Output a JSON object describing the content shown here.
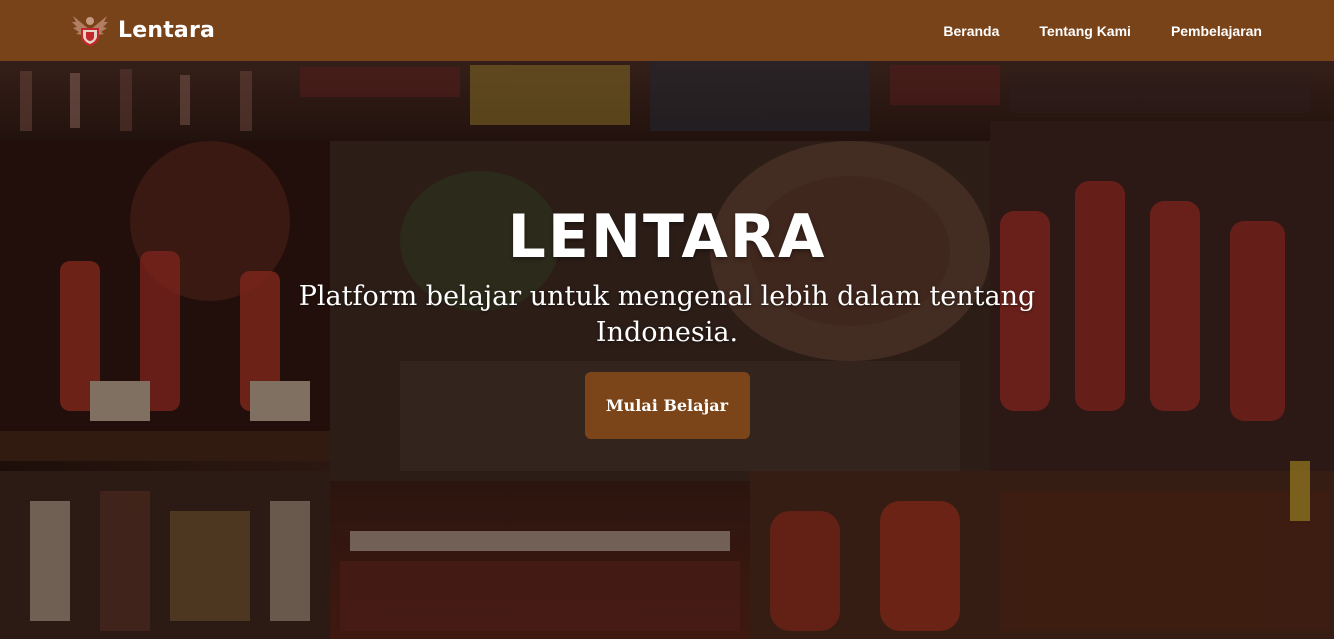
{
  "navbar": {
    "brand": {
      "name": "Lentara",
      "logo_icon": "garuda-logo-icon"
    },
    "links": [
      {
        "label": "Beranda"
      },
      {
        "label": "Tentang Kami"
      },
      {
        "label": "Pembelajaran"
      }
    ]
  },
  "hero": {
    "title": "LENTARA",
    "subtitle": "Platform belajar untuk mengenal lebih dalam tentang Indonesia.",
    "cta_label": "Mulai Belajar",
    "background_image": "collage of Indonesian traditional dance performances"
  },
  "colors": {
    "navbar_bg": "#79431a",
    "cta_bg": "#7b4519",
    "text": "#ffffff"
  }
}
